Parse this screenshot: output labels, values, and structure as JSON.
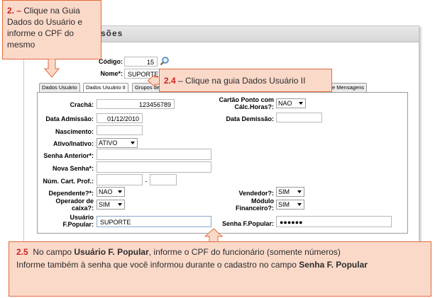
{
  "window": {
    "title": "sões"
  },
  "header": {
    "codigo_label": "Código:",
    "codigo_value": "15",
    "nome_label": "Nome*:",
    "nome_value": "SUPORTE"
  },
  "tabs": [
    {
      "label": "Dados Usuário"
    },
    {
      "label": "Dados Usuário II"
    },
    {
      "label": "Grupos de"
    },
    {
      "label": "e Mensagens"
    }
  ],
  "form": {
    "cracha_label": "Crachá:",
    "cracha_value": "123456789",
    "cartao_label_1": "Cartão Ponto com",
    "cartao_label_2": "Cálc.Horas?:",
    "cartao_value": "NAO",
    "data_admissao_label": "Data Admissão:",
    "data_admissao_value": "01/12/2010",
    "data_demissao_label": "Data Demissão:",
    "data_demissao_value": "",
    "nascimento_label": "Nascimento:",
    "nascimento_value": "",
    "ativo_label": "Ativo/Inativo:",
    "ativo_value": "ATIVO",
    "senha_anterior_label": "Senha Anterior*:",
    "nova_senha_label": "Nova Senha*:",
    "num_cart_label": "Núm. Cart. Prof.:",
    "num_cart_sep": "-",
    "dependente_label": "Dependente?*:",
    "dependente_value": "NAO",
    "vendedor_label": "Vendedor?:",
    "vendedor_value": "SIM",
    "operador_label_1": "Operador de",
    "operador_label_2": "caixa?:",
    "operador_value": "SIM",
    "modulo_label_1": "Módulo",
    "modulo_label_2": "Financeiro?:",
    "modulo_value": "SIM",
    "usuario_fp_label_1": "Usuário",
    "usuario_fp_label_2": "F.Popular:",
    "usuario_fp_value": "SUPORTE",
    "senha_fp_label": "Senha F.Popular:",
    "senha_fp_value": "●●●●●●"
  },
  "callouts": {
    "step2_num": "2. –",
    "step2_text_1": "Clique na Guia",
    "step2_text_2": "Dados do Usuário e",
    "step2_text_3": "informe o CPF do",
    "step2_text_4": "mesmo",
    "step24_num": "2.4",
    "step24_text": "– Clique na guia Dados Usuário II",
    "step25_num": "2.5",
    "step25_a": "No campo ",
    "step25_b": "Usuário F. Popular",
    "step25_c": ", informe o CPF do funcionário (somente números)",
    "step25_d": "Informe também à senha que você informou durante o cadastro no campo ",
    "step25_e": "Senha F. Popular"
  },
  "colors": {
    "callout_bg": "#fbd9c9",
    "callout_border": "#e06a3a",
    "callout_number": "#d02020"
  },
  "icons": {
    "search": "magnifier-icon"
  }
}
